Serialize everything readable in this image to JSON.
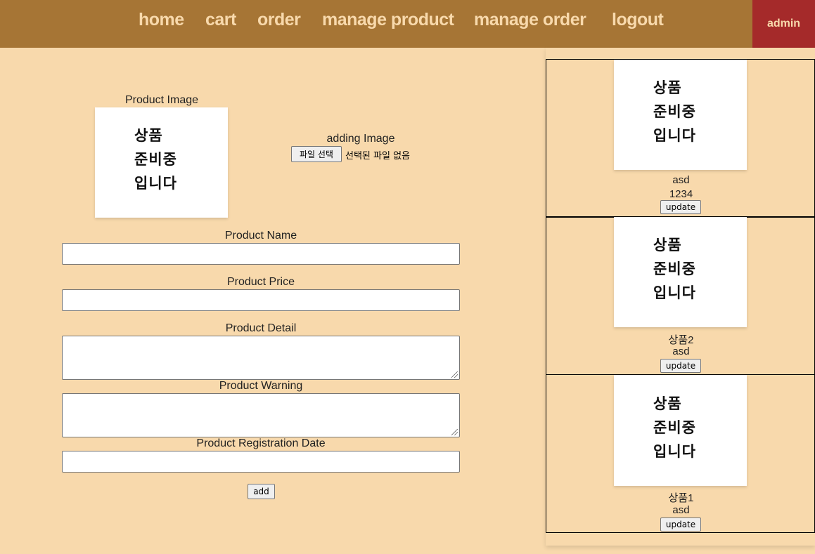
{
  "nav": {
    "items": [
      {
        "label": "home"
      },
      {
        "label": "cart"
      },
      {
        "label": "order"
      },
      {
        "label": "manage product"
      },
      {
        "label": "manage order"
      },
      {
        "label": "logout"
      }
    ],
    "user": "admin"
  },
  "form": {
    "image_label": "Product Image",
    "placeholder_lines": [
      "상품",
      "준비중",
      "입니다"
    ],
    "adding_image_label": "adding Image",
    "file_button": "파일 선택",
    "file_status": "선택된 파일 없음",
    "name_label": "Product Name",
    "price_label": "Product Price",
    "detail_label": "Product Detail",
    "warning_label": "Product Warning",
    "date_label": "Product Registration Date",
    "add_button": "add"
  },
  "products": [
    {
      "name": "asd",
      "detail": "1234",
      "button": "update"
    },
    {
      "name": "상품2",
      "detail": "asd",
      "button": "update"
    },
    {
      "name": "상품1",
      "detail": "asd",
      "button": "update"
    }
  ],
  "colors": {
    "background": "#f8d9ac",
    "navbar": "#a67535",
    "nav_text": "#f8d9ac",
    "user_badge": "#a52a2a"
  }
}
